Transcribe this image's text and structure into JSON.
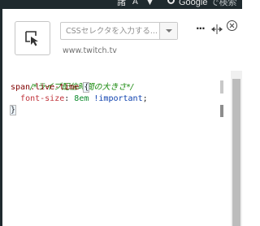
{
  "browser_bar": {
    "glyph1": "諸",
    "glyph2": "A",
    "glyph3": "▼",
    "search_brand": "Google",
    "search_suffix": "で検索"
  },
  "picker": {
    "icon": "element-picker-icon"
  },
  "selector": {
    "placeholder": "CSSセレクタを入力する...",
    "value": ""
  },
  "domain": "www.twitch.tv",
  "header_actions": {
    "more_label": "...",
    "resize_icon": "horizontal-resize-icon",
    "close_icon": "close-circle-icon"
  },
  "code": {
    "comment": "/*ライブ配信時間の大きさ*/",
    "selector": "span.live-time",
    "open_brace": "{",
    "property": "font-size",
    "colon": ":",
    "value": "8em",
    "important": "!important",
    "semicolon": ";",
    "close_brace": "}"
  },
  "colors": {
    "comment": "#1a8a0e",
    "selector": "#800000",
    "property": "#c0343b",
    "value": "#0b8a2c",
    "important": "#0b3fae"
  }
}
